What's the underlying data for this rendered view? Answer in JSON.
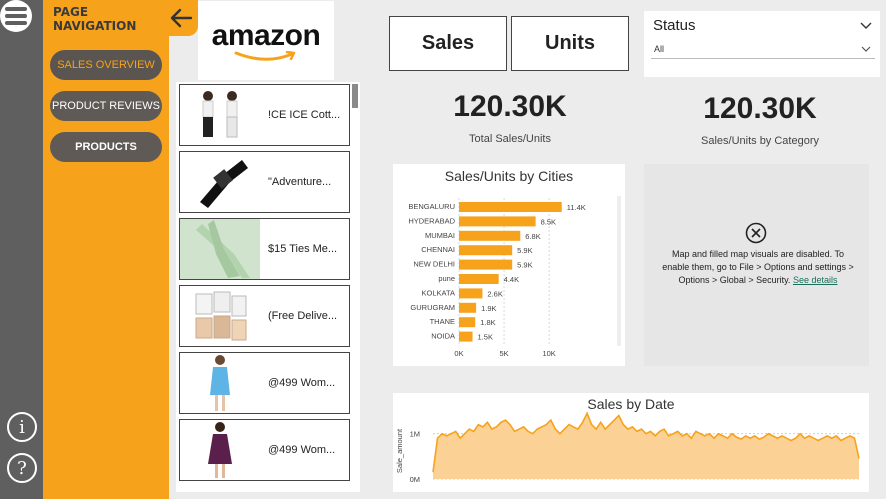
{
  "nav": {
    "title": "PAGE NAVIGATION",
    "items": [
      "SALES OVERVIEW",
      "PRODUCT REVIEWS",
      "PRODUCTS"
    ]
  },
  "logo": {
    "text": "amazon"
  },
  "products": [
    {
      "name": "!CE ICE Cott..."
    },
    {
      "name": "\"Adventure..."
    },
    {
      "name": "$15 Ties Me..."
    },
    {
      "name": "(Free Delive..."
    },
    {
      "name": "@499 Wom..."
    },
    {
      "name": "@499 Wom..."
    }
  ],
  "buttons": {
    "sales": "Sales",
    "units": "Units"
  },
  "status": {
    "label": "Status",
    "value": "All"
  },
  "kpi": {
    "total_value": "120.30K",
    "total_label": "Total  Sales/Units",
    "category_value": "120.30K",
    "category_label": "Sales/Units by Category"
  },
  "map_notice": {
    "text": "Map and filled map visuals are disabled. To enable them, go to File > Options and settings > Options > Global > Security.",
    "link": "See details"
  },
  "colors": {
    "accent": "#f7a21b",
    "rail": "#5f5f5f"
  },
  "chart_data": [
    {
      "type": "bar",
      "title": "Sales/Units by Cities",
      "categories": [
        "BENGALURU",
        "HYDERABAD",
        "MUMBAI",
        "CHENNAI",
        "NEW DELHI",
        "pune",
        "KOLKATA",
        "GURUGRAM",
        "THANE",
        "NOIDA"
      ],
      "values": [
        11400,
        8500,
        6800,
        5900,
        5900,
        4400,
        2600,
        1900,
        1800,
        1500
      ],
      "value_labels": [
        "11.4K",
        "8.5K",
        "6.8K",
        "5.9K",
        "5.9K",
        "4.4K",
        "2.6K",
        "1.9K",
        "1.8K",
        "1.5K"
      ],
      "xticks": [
        "0K",
        "5K",
        "10K"
      ],
      "xlim": [
        0,
        12000
      ]
    },
    {
      "type": "area",
      "title": "Sales by Date",
      "ylabel": "Sale_amount",
      "yticks": [
        "0M",
        "1M"
      ],
      "ylim": [
        0,
        1.5
      ],
      "values": [
        0.15,
        0.9,
        1.0,
        0.95,
        1.0,
        1.05,
        0.9,
        1.0,
        1.1,
        1.05,
        1.2,
        1.15,
        1.25,
        1.1,
        1.15,
        1.25,
        1.3,
        1.2,
        1.05,
        1.1,
        1.15,
        1.05,
        1.0,
        1.1,
        1.15,
        1.2,
        1.3,
        1.1,
        1.0,
        1.1,
        1.2,
        1.15,
        1.1,
        1.25,
        1.45,
        1.2,
        1.1,
        1.25,
        1.1,
        1.2,
        1.3,
        1.4,
        1.2,
        1.1,
        1.15,
        1.05,
        1.1,
        1.0,
        1.05,
        0.95,
        1.05,
        1.1,
        0.95,
        1.0,
        1.05,
        0.95,
        1.0,
        0.9,
        1.05,
        1.0,
        0.95,
        1.0,
        0.9,
        1.0,
        0.95,
        0.9,
        1.0,
        0.92,
        0.88,
        0.95,
        0.9,
        0.95,
        0.88,
        0.92,
        1.0,
        0.95,
        0.9,
        0.95,
        0.9,
        0.85,
        0.9,
        1.0,
        0.9,
        0.95,
        0.9,
        0.85,
        0.9,
        0.95,
        0.9,
        0.95,
        0.85,
        0.9,
        0.95,
        0.9,
        0.45
      ]
    }
  ]
}
